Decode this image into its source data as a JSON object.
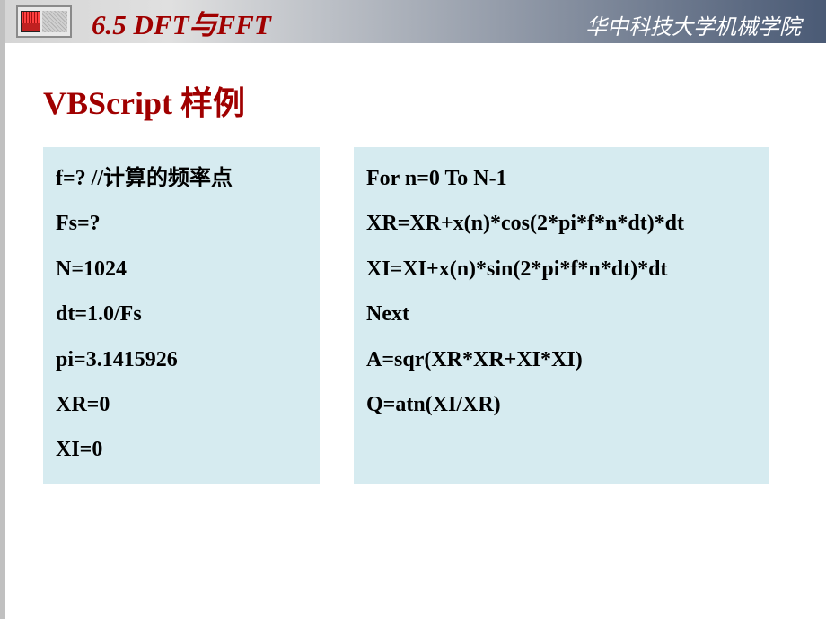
{
  "header": {
    "chapter_title": "6.5  DFT与FFT",
    "institution": "华中科技大学机械学院"
  },
  "section_title": "VBScript 样例",
  "code_left": {
    "lines": [
      "f=?   //计算的频率点",
      "Fs=?",
      "N=1024",
      "dt=1.0/Fs",
      "pi=3.1415926",
      "XR=0",
      "XI=0"
    ]
  },
  "code_right": {
    "lines": [
      "For n=0 To N-1",
      " XR=XR+x(n)*cos(2*pi*f*n*dt)*dt",
      " XI=XI+x(n)*sin(2*pi*f*n*dt)*dt",
      "Next",
      "A=sqr(XR*XR+XI*XI)",
      "Q=atn(XI/XR)"
    ]
  }
}
